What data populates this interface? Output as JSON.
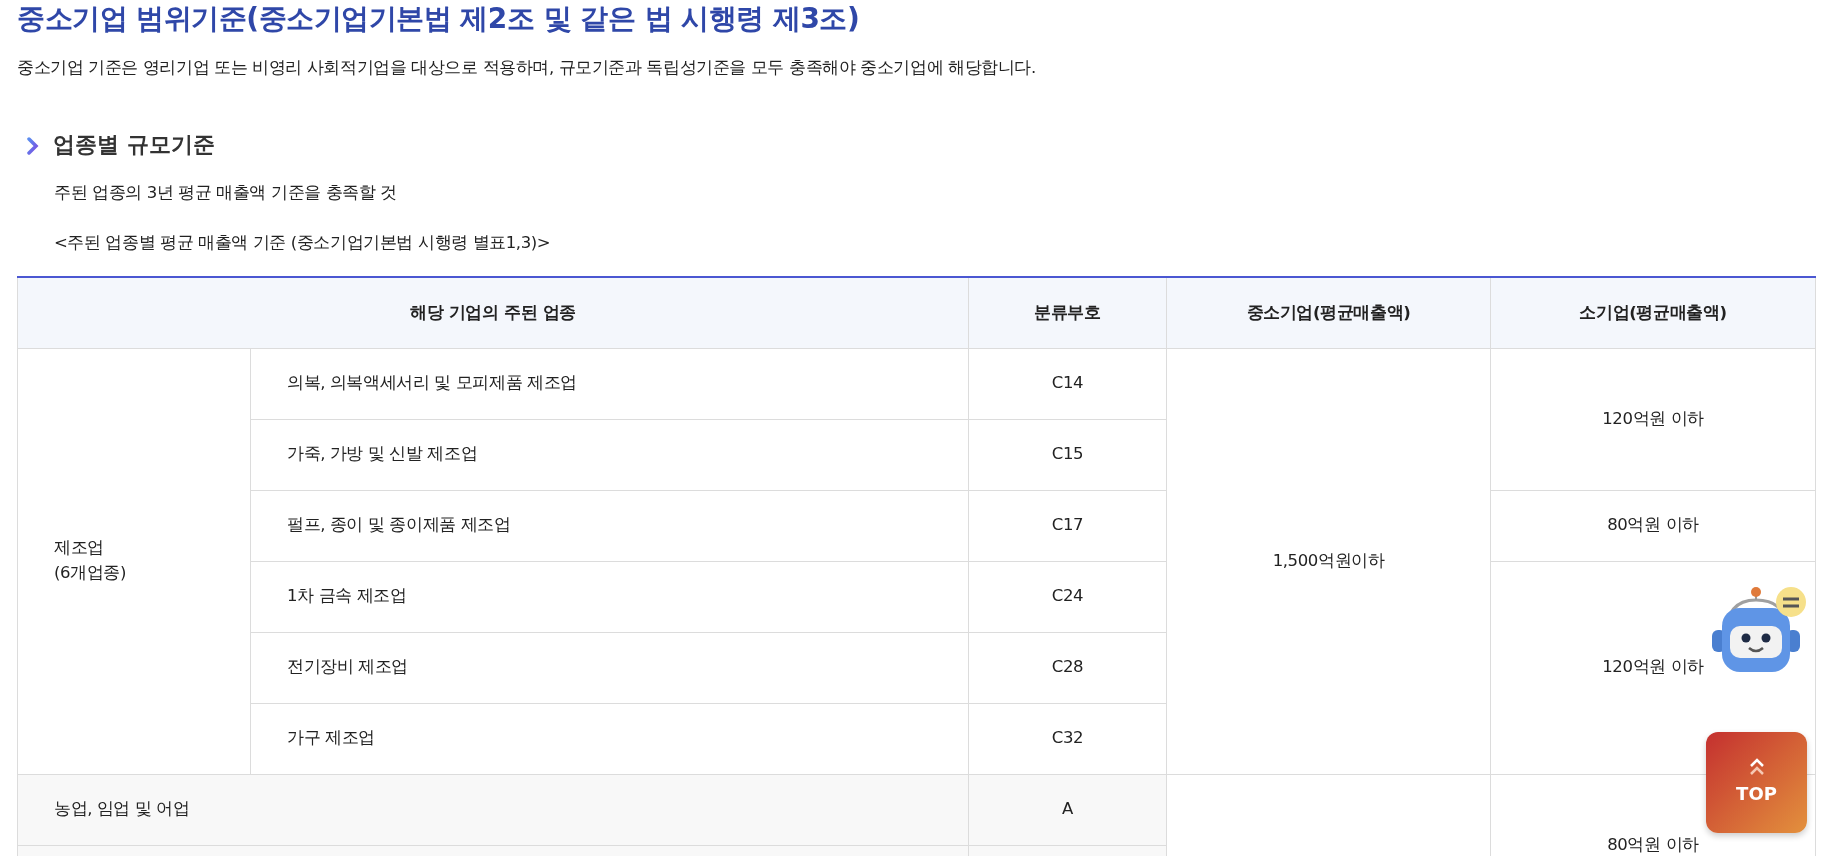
{
  "title": "중소기업 범위기준(중소기업기본법 제2조 및 같은 법 시행령 제3조)",
  "intro": "중소기업 기준은 영리기업 또는 비영리 사회적기업을 대상으로 적용하며, 규모기준과 독립성기준을 모두 충족해야 중소기업에 해당합니다.",
  "section": {
    "heading": "업종별 규모기준",
    "lines": [
      "주된 업종의 3년 평균 매출액 기준을 충족할 것",
      "<주된 업종별 평균 매출액 기준 (중소기업기본법 시행령 별표1,3)>"
    ]
  },
  "table": {
    "columns": [
      "해당 기업의 주된 업종",
      "분류부호",
      "중소기업(평균매출액)",
      "소기업(평균매출액)"
    ],
    "groups": [
      {
        "kind": "category",
        "category": [
          "제조업",
          "(6개업종)"
        ],
        "sme": "1,500억원이하",
        "bands": [
          {
            "small": "120억원 이하",
            "industries": [
              {
                "name": "의복, 의복액세서리 및 모피제품 제조업",
                "code": "C14"
              },
              {
                "name": "가죽, 가방 및 신발 제조업",
                "code": "C15"
              }
            ]
          },
          {
            "small": "80억원 이하",
            "industries": [
              {
                "name": "펄프, 종이 및 종이제품 제조업",
                "code": "C17"
              }
            ]
          },
          {
            "small": "120억원 이하",
            "industries": [
              {
                "name": "1차 금속 제조업",
                "code": "C24"
              },
              {
                "name": "전기장비 제조업",
                "code": "C28"
              },
              {
                "name": "가구 제조업",
                "code": "C32"
              }
            ]
          }
        ]
      },
      {
        "kind": "single",
        "bands": [
          {
            "small": "80억원 이하",
            "continues_below": true,
            "industries": [
              {
                "name": "농업, 임업 및 어업",
                "code": "A"
              }
            ]
          }
        ]
      }
    ]
  },
  "buttons": {
    "top": "TOP"
  }
}
